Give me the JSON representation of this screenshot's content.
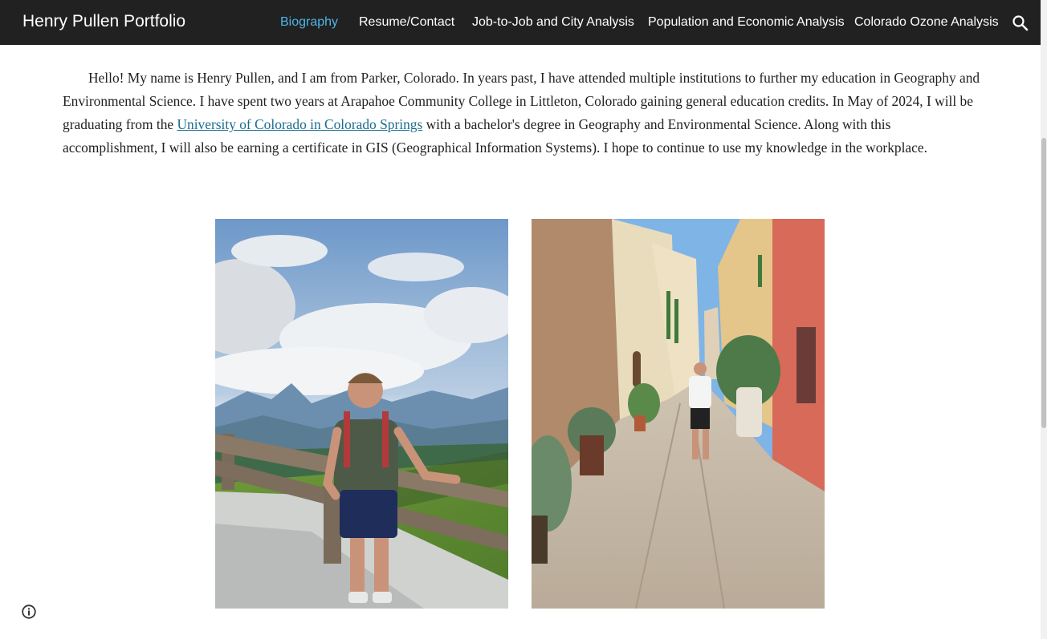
{
  "header": {
    "site_title": "Henry Pullen Portfolio",
    "nav": [
      {
        "label": "Biography",
        "active": true
      },
      {
        "label": "Resume/Contact",
        "active": false
      },
      {
        "label": "Job-to-Job and City Analysis",
        "active": false
      },
      {
        "label": "Population and Economic Analysis",
        "active": false
      },
      {
        "label": "Colorado Ozone Analysis",
        "active": false
      }
    ],
    "search_icon": "search-icon"
  },
  "bio": {
    "text_before_link": "Hello! My name is Henry Pullen, and I am from Parker, Colorado. In years past, I have attended multiple institutions to further my education in Geography and Environmental Science. I have spent two years at Arapahoe Community College in Littleton, Colorado gaining general education credits. In May of 2024, I will be graduating from the ",
    "link_text": "University of Colorado in Colorado Springs",
    "text_after_link": " with a bachelor's degree in Geography and Environmental Science. Along with this accomplishment, I will also be earning a certificate in GIS (Geographical Information Systems). I hope to continue to use my knowledge in the workplace."
  },
  "photos": [
    {
      "icon": "mountain-photo"
    },
    {
      "icon": "street-photo"
    }
  ],
  "footer": {
    "info_icon": "info-icon"
  },
  "colors": {
    "topbar": "#212121",
    "nav_active": "#4db6e4",
    "link": "#1a6d8f"
  }
}
